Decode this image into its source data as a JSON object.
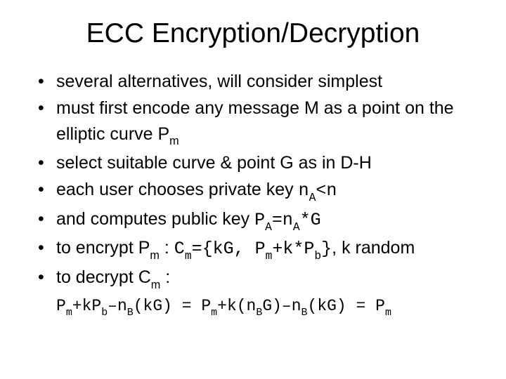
{
  "title": "ECC Encryption/Decryption",
  "bullets": {
    "b1": "several alternatives, will consider simplest",
    "b2_a": "must first encode any message M as a point on the elliptic curve P",
    "b2_sub": "m",
    "b3": "select suitable curve & point G as in D-H",
    "b4_a": "each user chooses private key ",
    "b4_mono1": "n",
    "b4_sub1": "A",
    "b4_mono2": "<n",
    "b5_a": "and computes public key ",
    "b5_m1": "P",
    "b5_s1": "A",
    "b5_m2": "=n",
    "b5_s2": "A",
    "b5_m3": "*G",
    "b6_a": "to encrypt P",
    "b6_s1": "m",
    "b6_b": " : ",
    "b6_m1": "C",
    "b6_s2": "m",
    "b6_m2": "={kG, P",
    "b6_s3": "m",
    "b6_m3": "+k*P",
    "b6_s4": "b",
    "b6_m4": "}",
    "b6_c": ", k random",
    "b7_a": "to decrypt C",
    "b7_s1": "m",
    "b7_b": " :"
  },
  "formula": {
    "p1": "P",
    "s1": "m",
    "p2": "+kP",
    "s2": "b",
    "p3": "–n",
    "s3": "B",
    "p4": "(kG) = P",
    "s4": "m",
    "p5": "+k(n",
    "s5": "B",
    "p6": "G)–n",
    "s6": "B",
    "p7": "(kG) = P",
    "s7": "m"
  }
}
